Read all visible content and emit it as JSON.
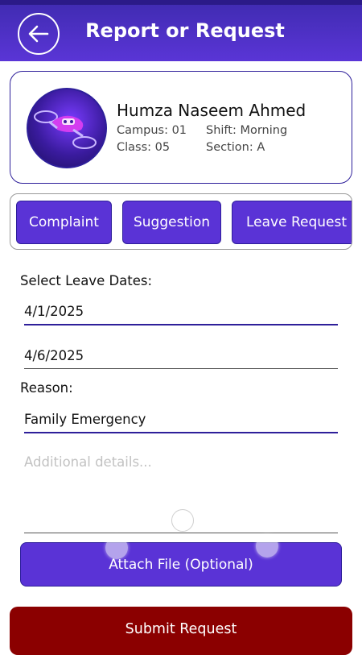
{
  "header": {
    "title": "Report or Request",
    "back_icon": "arrow-left-icon",
    "colors": {
      "bar": "#4a2fc4",
      "accent": "#5a33d6"
    }
  },
  "student": {
    "name": "Humza Naseem Ahmed",
    "campus": "Campus: 01",
    "shift": "Shift: Morning",
    "class": "Class: 05",
    "section": "Section: A",
    "avatar_icon": "drone-avatar-icon"
  },
  "tabs": [
    {
      "label": "Complaint"
    },
    {
      "label": "Suggestion"
    },
    {
      "label": "Leave Request"
    }
  ],
  "form": {
    "dates_label": "Select Leave Dates:",
    "start_date": "4/1/2025",
    "end_date": "4/6/2025",
    "reason_label": "Reason:",
    "reason_value": "Family Emergency",
    "details_placeholder": "Additional details..."
  },
  "actions": {
    "attach_label": "Attach File (Optional)",
    "submit_label": "Submit Request",
    "submit_color": "#8b0000"
  }
}
